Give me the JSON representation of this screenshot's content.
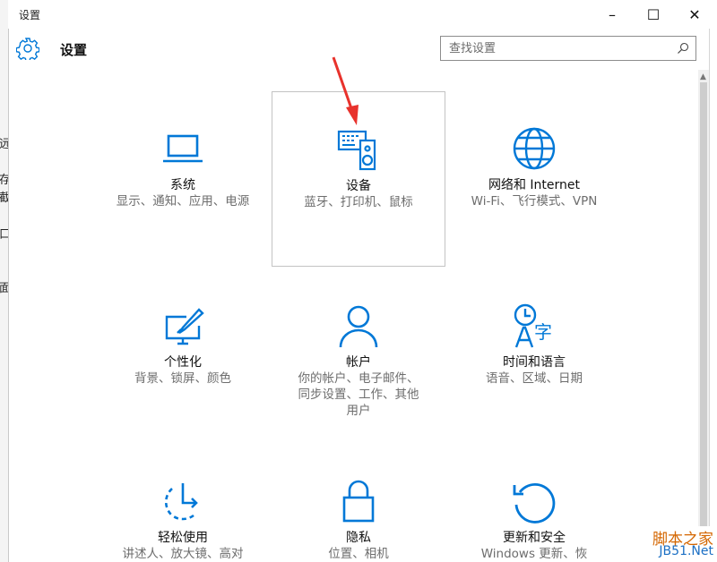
{
  "window": {
    "title": "设置",
    "minimize_glyph": "–",
    "maximize_glyph": "☐",
    "close_glyph": "✕"
  },
  "header": {
    "title": "设置",
    "icon": "gear-icon",
    "search": {
      "placeholder": "查找设置",
      "icon": "search-icon"
    }
  },
  "tiles": [
    {
      "id": "system",
      "icon": "laptop-icon",
      "label": "系统",
      "description": "显示、通知、应用、电源"
    },
    {
      "id": "devices",
      "icon": "devices-icon",
      "label": "设备",
      "description": "蓝牙、打印机、鼠标"
    },
    {
      "id": "network",
      "icon": "globe-icon",
      "label": "网络和 Internet",
      "description": "Wi-Fi、飞行模式、VPN"
    },
    {
      "id": "personalization",
      "icon": "personalization-icon",
      "label": "个性化",
      "description": "背景、锁屏、颜色"
    },
    {
      "id": "accounts",
      "icon": "person-icon",
      "label": "帐户",
      "description": "你的帐户、电子邮件、同步设置、工作、其他用户"
    },
    {
      "id": "time-language",
      "icon": "time-language-icon",
      "label": "时间和语言",
      "description": "语音、区域、日期"
    },
    {
      "id": "ease-of-access",
      "icon": "ease-of-access-icon",
      "label": "轻松使用",
      "description": "讲述人、放大镜、高对"
    },
    {
      "id": "privacy",
      "icon": "lock-icon",
      "label": "隐私",
      "description": "位置、相机"
    },
    {
      "id": "update-security",
      "icon": "refresh-icon",
      "label": "更新和安全",
      "description": "Windows 更新、恢"
    }
  ],
  "selected_tile": "devices",
  "watermark": {
    "line1": "脚本之家",
    "line2": "JB51.Net"
  },
  "colors": {
    "accent": "#0078d7",
    "annotation_arrow": "#e8322c",
    "watermark_orange": "#d46600",
    "watermark_blue": "#1b6fc4"
  }
}
